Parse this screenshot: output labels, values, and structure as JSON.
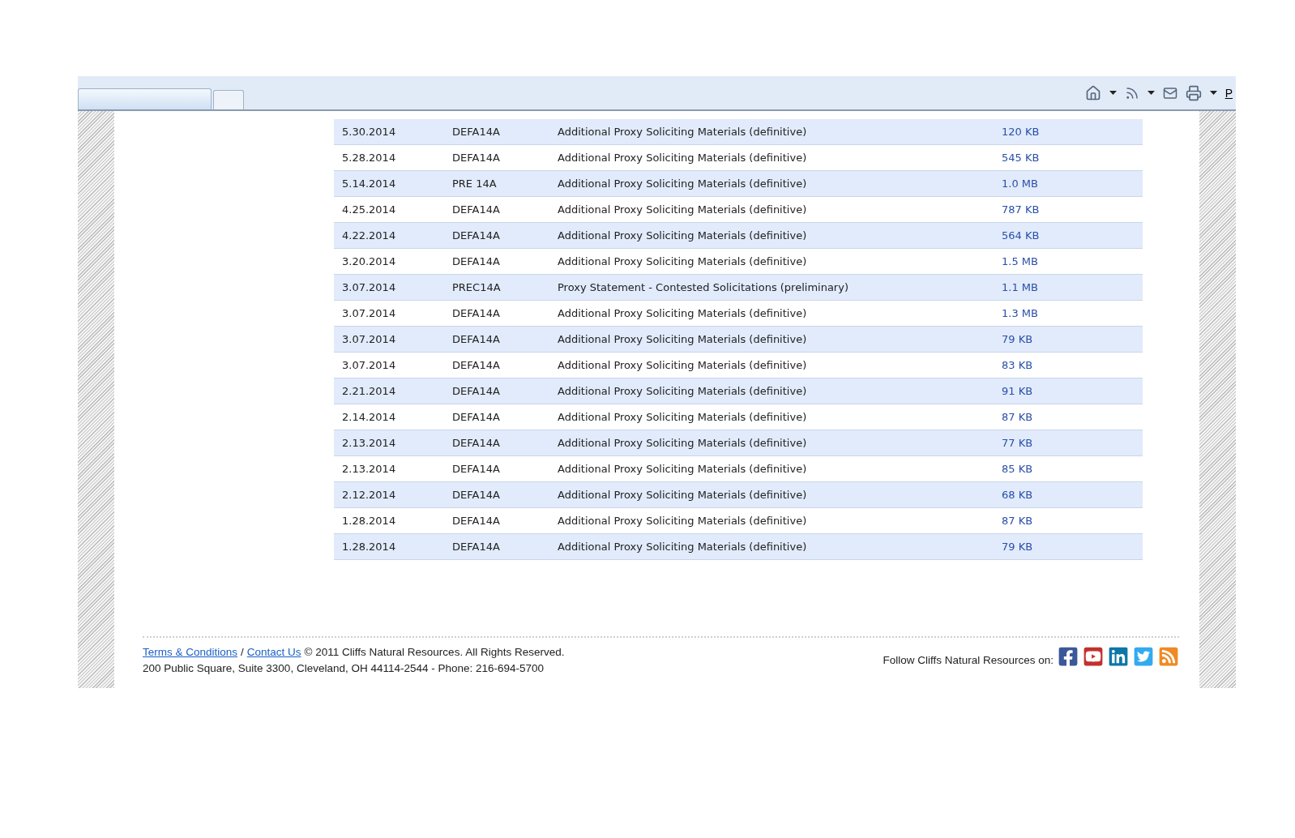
{
  "toolbar": {
    "tabs": [
      {
        "selected": true
      },
      {
        "selected": false
      }
    ],
    "link": "P"
  },
  "filings": [
    {
      "date": "5.30.2014",
      "type": "DEFA14A",
      "description": "Additional Proxy Soliciting Materials (definitive)",
      "size": "120 KB"
    },
    {
      "date": "5.28.2014",
      "type": "DEFA14A",
      "description": "Additional Proxy Soliciting Materials (definitive)",
      "size": "545 KB"
    },
    {
      "date": "5.14.2014",
      "type": "PRE 14A",
      "description": "Additional Proxy Soliciting Materials (definitive)",
      "size": "1.0 MB"
    },
    {
      "date": "4.25.2014",
      "type": "DEFA14A",
      "description": "Additional Proxy Soliciting Materials (definitive)",
      "size": "787 KB"
    },
    {
      "date": "4.22.2014",
      "type": "DEFA14A",
      "description": "Additional Proxy Soliciting Materials (definitive)",
      "size": "564 KB"
    },
    {
      "date": "3.20.2014",
      "type": "DEFA14A",
      "description": "Additional Proxy Soliciting Materials (definitive)",
      "size": "1.5 MB"
    },
    {
      "date": "3.07.2014",
      "type": "PREC14A",
      "description": "Proxy Statement - Contested Solicitations (preliminary)",
      "size": "1.1 MB"
    },
    {
      "date": "3.07.2014",
      "type": "DEFA14A",
      "description": "Additional Proxy Soliciting Materials (definitive)",
      "size": "1.3 MB"
    },
    {
      "date": "3.07.2014",
      "type": "DEFA14A",
      "description": "Additional Proxy Soliciting Materials (definitive)",
      "size": "79 KB"
    },
    {
      "date": "3.07.2014",
      "type": "DEFA14A",
      "description": "Additional Proxy Soliciting Materials (definitive)",
      "size": "83 KB"
    },
    {
      "date": "2.21.2014",
      "type": "DEFA14A",
      "description": "Additional Proxy Soliciting Materials (definitive)",
      "size": "91 KB"
    },
    {
      "date": "2.14.2014",
      "type": "DEFA14A",
      "description": "Additional Proxy Soliciting Materials (definitive)",
      "size": "87 KB"
    },
    {
      "date": "2.13.2014",
      "type": "DEFA14A",
      "description": "Additional Proxy Soliciting Materials (definitive)",
      "size": "77 KB"
    },
    {
      "date": "2.13.2014",
      "type": "DEFA14A",
      "description": "Additional Proxy Soliciting Materials (definitive)",
      "size": "85 KB"
    },
    {
      "date": "2.12.2014",
      "type": "DEFA14A",
      "description": "Additional Proxy Soliciting Materials (definitive)",
      "size": "68 KB"
    },
    {
      "date": "1.28.2014",
      "type": "DEFA14A",
      "description": "Additional Proxy Soliciting Materials (definitive)",
      "size": "87 KB"
    },
    {
      "date": "1.28.2014",
      "type": "DEFA14A",
      "description": "Additional Proxy Soliciting Materials (definitive)",
      "size": "79 KB"
    }
  ],
  "footer": {
    "links": [
      "Terms & Conditions",
      "Contact Us"
    ],
    "separator": "/",
    "copyright": "© 2011 Cliffs Natural Resources. All Rights Reserved.",
    "address": "200 Public Square, Suite 3300, Cleveland, OH 44114-2544 - Phone: 216-694-5700",
    "follow": "Follow Cliffs Natural Resources on:"
  }
}
